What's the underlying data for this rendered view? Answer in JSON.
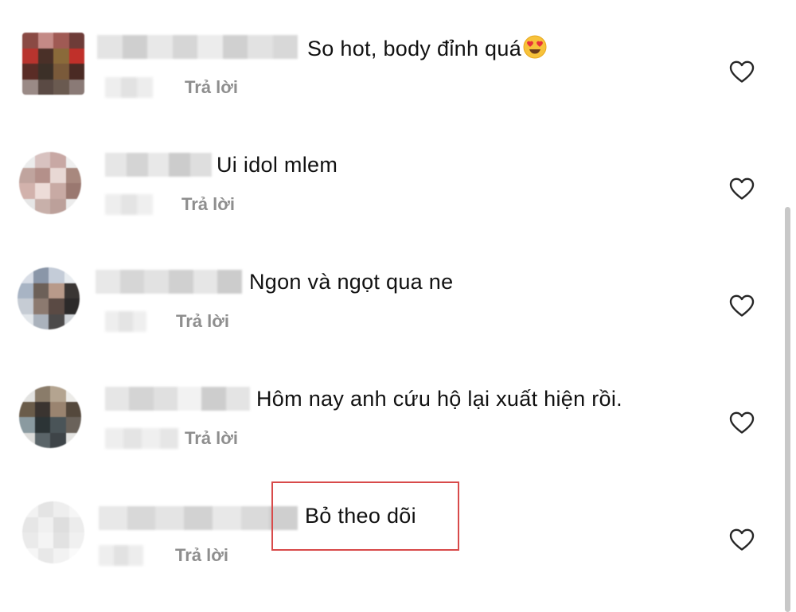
{
  "colors": {
    "text": "#111111",
    "reply": "#8e8e8e",
    "highlight_border": "#d84a4a",
    "scrollbar": "#c8c8c8"
  },
  "comments": [
    {
      "text": "So hot, body đỉnh quá",
      "has_emoji": true,
      "emoji": "heart-eyes-emoji",
      "reply_label": "Trả lời",
      "like_icon": "heart-outline-icon"
    },
    {
      "text": "Ui idol mlem",
      "has_emoji": false,
      "reply_label": "Trả lời",
      "like_icon": "heart-outline-icon"
    },
    {
      "text": "Ngon và ngọt qua ne",
      "has_emoji": false,
      "reply_label": "Trả lời",
      "like_icon": "heart-outline-icon"
    },
    {
      "text": "Hôm nay anh cứu hộ lại xuất hiện rồi.",
      "has_emoji": false,
      "reply_label": "Trả lời",
      "like_icon": "heart-outline-icon"
    },
    {
      "text": "Bỏ theo dõi",
      "has_emoji": false,
      "reply_label": "Trả lời",
      "like_icon": "heart-outline-icon",
      "highlighted": true
    }
  ]
}
